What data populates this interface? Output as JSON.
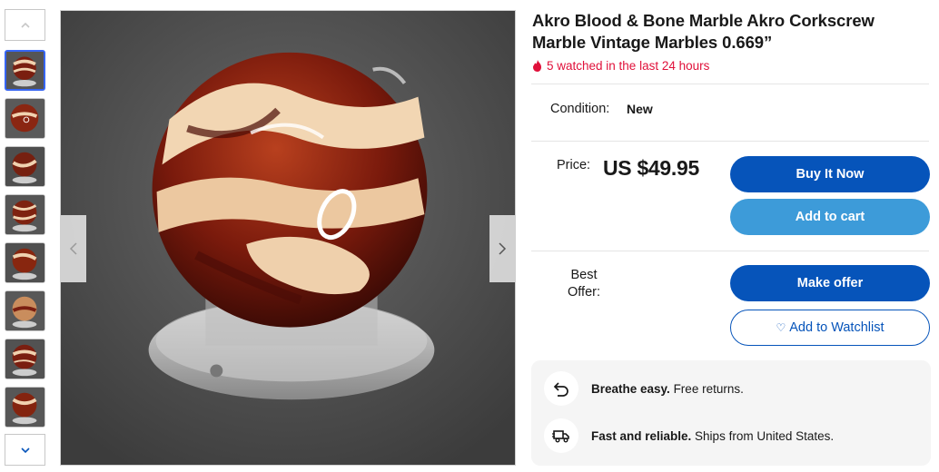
{
  "listing": {
    "title": "Akro Blood & Bone Marble Akro Corkscrew Marble Vintage Marbles 0.669”",
    "watch_text": "5 watched in the last 24 hours"
  },
  "condition": {
    "label": "Condition:",
    "value": "New"
  },
  "price": {
    "label": "Price:",
    "value": "US $49.95"
  },
  "best_offer": {
    "label": "Best Offer:"
  },
  "buttons": {
    "buy_now": "Buy It Now",
    "add_to_cart": "Add to cart",
    "make_offer": "Make offer",
    "watchlist": "Add to Watchlist"
  },
  "perks": [
    {
      "bold": "Breathe easy.",
      "text": " Free returns.",
      "icon": "return-arrow-icon"
    },
    {
      "bold": "Fast and reliable.",
      "text": " Ships from United States.",
      "icon": "truck-icon"
    }
  ],
  "gallery": {
    "thumbnail_count": 8,
    "selected_index": 0,
    "icons": [
      "chevron-up-icon",
      "chevron-down-icon",
      "chevron-left-icon",
      "chevron-right-icon"
    ]
  },
  "colors": {
    "primary_blue": "#0654ba",
    "secondary_blue": "#3d9bd9",
    "watch_red": "#e0103a",
    "selected_thumb_border": "#3665f3"
  }
}
